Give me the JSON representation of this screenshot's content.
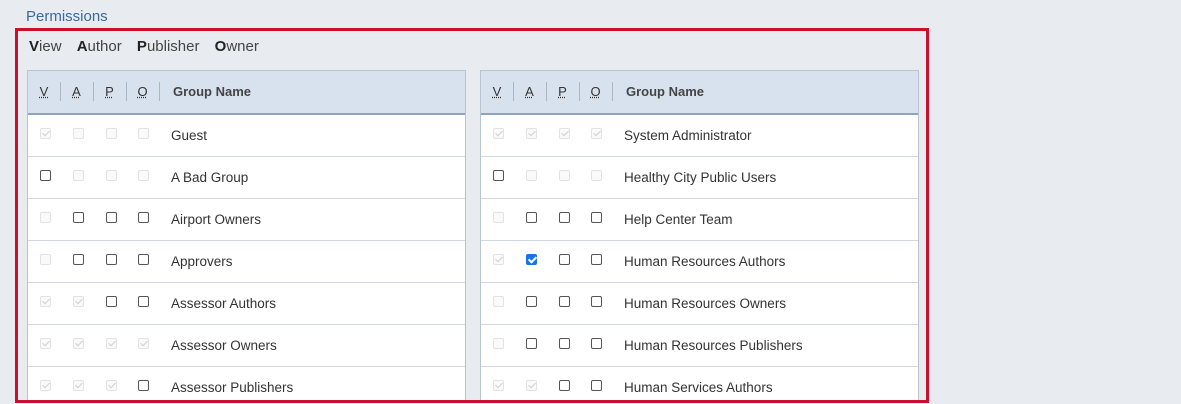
{
  "section_title": "Permissions",
  "legend": [
    {
      "initial": "V",
      "rest": "iew"
    },
    {
      "initial": "A",
      "rest": "uthor"
    },
    {
      "initial": "P",
      "rest": "ublisher"
    },
    {
      "initial": "O",
      "rest": "wner"
    }
  ],
  "headers": {
    "v": "V",
    "a": "A",
    "p": "P",
    "o": "O",
    "group_name": "Group Name"
  },
  "left_rows": [
    {
      "name": "Guest",
      "checks": [
        "dc",
        "d",
        "d",
        "d"
      ]
    },
    {
      "name": "A Bad Group",
      "checks": [
        "e",
        "d",
        "d",
        "d"
      ]
    },
    {
      "name": "Airport Owners",
      "checks": [
        "d",
        "e",
        "e",
        "e"
      ]
    },
    {
      "name": "Approvers",
      "checks": [
        "d",
        "e",
        "e",
        "e"
      ]
    },
    {
      "name": "Assessor Authors",
      "checks": [
        "dc",
        "dc",
        "e",
        "e"
      ]
    },
    {
      "name": "Assessor Owners",
      "checks": [
        "dc",
        "dc",
        "dc",
        "dc"
      ]
    },
    {
      "name": "Assessor Publishers",
      "checks": [
        "dc",
        "dc",
        "dc",
        "e"
      ]
    }
  ],
  "right_rows": [
    {
      "name": "System Administrator",
      "checks": [
        "dc",
        "dc",
        "dc",
        "dc"
      ]
    },
    {
      "name": "Healthy City Public Users",
      "checks": [
        "e",
        "d",
        "d",
        "d"
      ]
    },
    {
      "name": "Help Center Team",
      "checks": [
        "d",
        "e",
        "e",
        "e"
      ]
    },
    {
      "name": "Human Resources Authors",
      "checks": [
        "dc",
        "on",
        "e",
        "e"
      ]
    },
    {
      "name": "Human Resources Owners",
      "checks": [
        "d",
        "e",
        "e",
        "e"
      ]
    },
    {
      "name": "Human Resources Publishers",
      "checks": [
        "d",
        "e",
        "e",
        "e"
      ]
    },
    {
      "name": "Human Services Authors",
      "checks": [
        "dc",
        "dc",
        "e",
        "e"
      ]
    }
  ]
}
